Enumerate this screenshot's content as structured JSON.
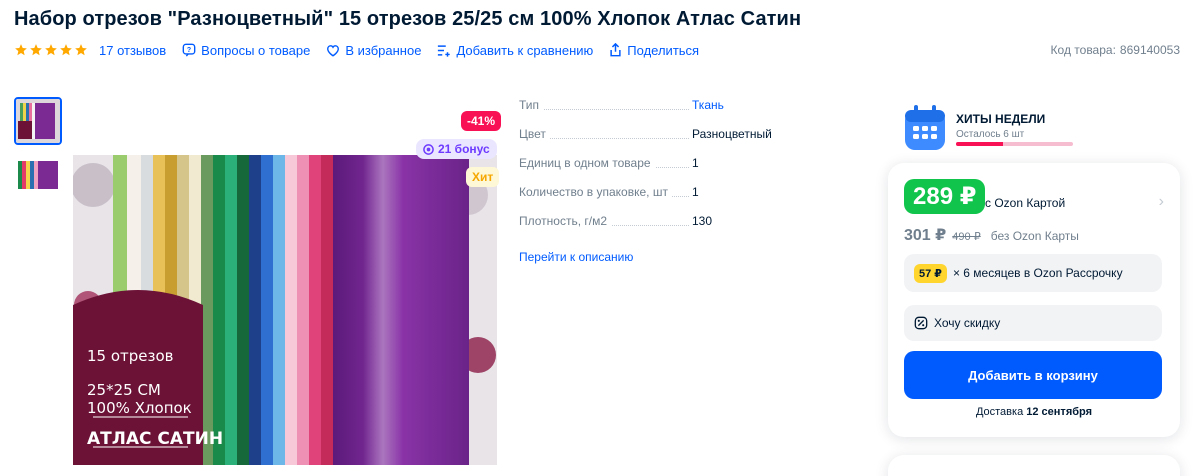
{
  "product": {
    "title": "Набор отрезов \"Разноцветный\" 15 отрезов 25/25 см 100% Хлопок Атлас Сатин",
    "rating": 5,
    "reviews": "17 отзывов",
    "questions": "Вопросы о товаре",
    "favorite": "В избранное",
    "compare": "Добавить к сравнению",
    "share": "Поделиться",
    "code_label": "Код товара:",
    "code_value": "869140053"
  },
  "gallery": {
    "discount": "-41%",
    "bonus": "21 бонус",
    "hit": "Хит",
    "overlay_line1": "15 отрезов",
    "overlay_line2": "25*25 СМ",
    "overlay_line3": "100% Хлопок",
    "overlay_line4": "АТЛАС САТИН"
  },
  "specs": [
    {
      "key": "Тип",
      "value": "Ткань"
    },
    {
      "key": "Цвет",
      "value": "Разноцветный"
    },
    {
      "key": "Единиц в одном товаре",
      "value": "1"
    },
    {
      "key": "Количество в упаковке, шт",
      "value": "1"
    },
    {
      "key": "Плотность, г/м2",
      "value": "130"
    }
  ],
  "goto_description": "Перейти к описанию",
  "hits": {
    "title": "ХИТЫ НЕДЕЛИ",
    "subtitle": "Осталось 6 шт",
    "remaining_fraction": 0.4
  },
  "price": {
    "card_price": "289 ₽",
    "card_label": "с Ozon Картой",
    "price": "301 ₽",
    "old_price": "490 ₽",
    "no_card_label": "без Ozon Карты",
    "installment_badge": "57 ₽",
    "installment_text": "× 6 месяцев в Ozon Рассрочку",
    "want_discount": "Хочу скидку",
    "add_to_cart": "Добавить в корзину",
    "delivery_prefix": "Доставка",
    "delivery_date": "12 сентября"
  },
  "colors": {
    "accent": "#005bff",
    "green": "#10c44c",
    "pink": "#f91155",
    "star": "#ffa800"
  }
}
